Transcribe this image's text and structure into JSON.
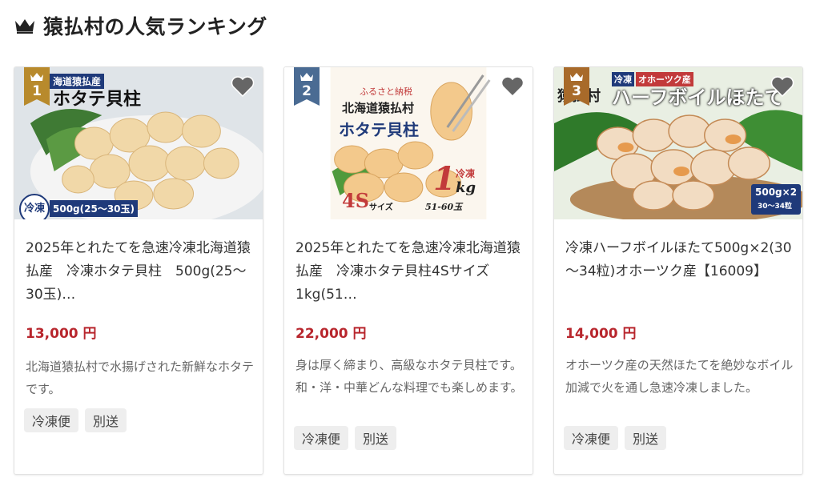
{
  "header": {
    "title": "猿払村の人気ランキング",
    "icon": "crown-icon"
  },
  "colors": {
    "gold": "#b88a2c",
    "silver": "#4a6b93",
    "bronze": "#a86a2a",
    "price": "#b8262d",
    "tag_bg": "#eeeeee"
  },
  "products": [
    {
      "rank": "1",
      "name": "2025年とれたてを急速冷凍北海道猿払産　冷凍ホタテ貝柱　500g(25～30玉)…",
      "price": "13,000 円",
      "description": "北海道猿払村で水揚げされた新鮮なホタテです。",
      "tags": [
        "冷凍便",
        "別送"
      ],
      "image_text": {
        "top_label": "海道猿払産",
        "title": "ホタテ貝柱",
        "badge": "冷凍",
        "weight": "500g(25〜30玉)"
      }
    },
    {
      "rank": "2",
      "name": "2025年とれたてを急速冷凍北海道猿払産　冷凍ホタテ貝柱4Sサイズ　1kg(51…",
      "price": "22,000 円",
      "description": "身は厚く締まり、高級なホタテ貝柱です。和・洋・中華どんな料理でも楽しめます。",
      "tags": [
        "冷凍便",
        "別送"
      ],
      "image_text": {
        "tagline": "ふるさと納税",
        "line1": "北海道猿払村",
        "line2": "ホタテ貝柱",
        "frozen": "冷凍",
        "qty": "1",
        "unit": "kg",
        "size": "4S",
        "size_suffix": "サイズ",
        "count": "51-60玉"
      }
    },
    {
      "rank": "3",
      "name": "冷凍ハーフボイルほたて500g×2(30～34粒)オホーツク産【16009】",
      "price": "14,000 円",
      "description": "オホーツク産の天然ほたてを絶妙なボイル加減で火を通し急速冷凍しました。",
      "tags": [
        "冷凍便",
        "別送"
      ],
      "image_text": {
        "label_frozen": "冷凍",
        "label_origin": "オホーツク産",
        "left": "猿払村",
        "title": "ハーフボイルほたて",
        "weight": "500g×2",
        "count": "30〜34粒"
      }
    }
  ]
}
